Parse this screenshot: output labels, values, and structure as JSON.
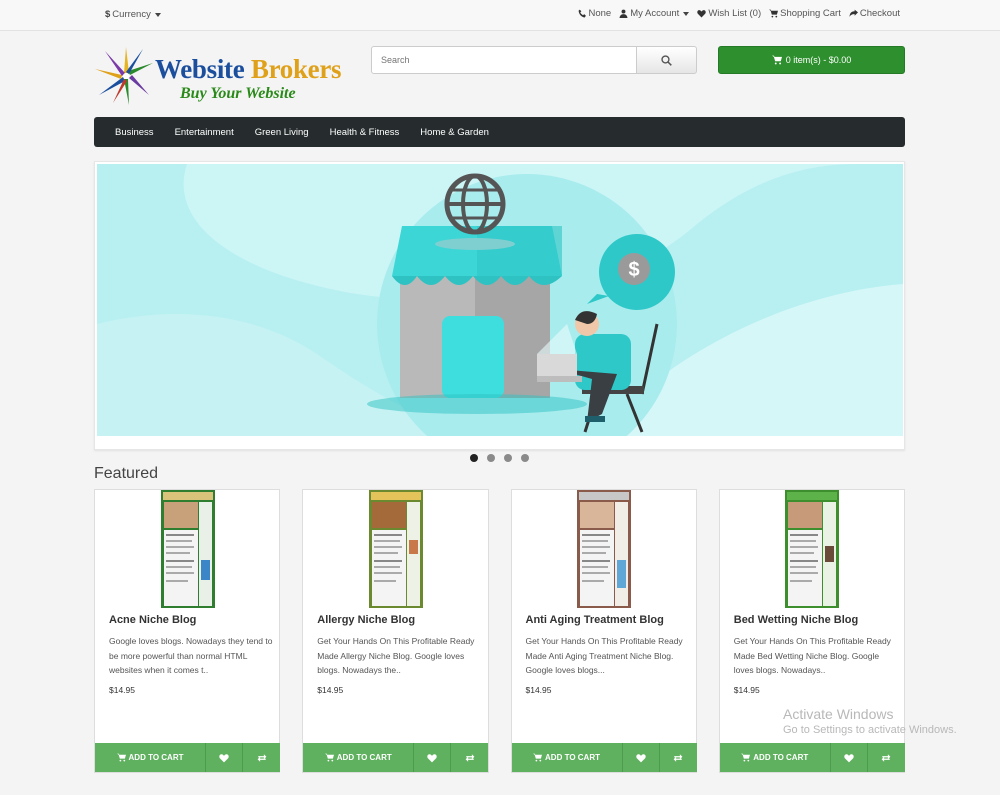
{
  "topbar": {
    "currency_symbol": "$",
    "currency_label": "Currency",
    "links": {
      "phone": "None",
      "account": "My Account",
      "wishlist": "Wish List (0)",
      "cart": "Shopping Cart",
      "checkout": "Checkout"
    }
  },
  "header": {
    "logo_word1": "Website",
    "logo_word2": "Brokers",
    "logo_tagline": "Buy Your Website",
    "search_placeholder": "Search",
    "cart_summary": "0 item(s) - $0.00"
  },
  "nav": {
    "items": [
      "Business",
      "Entertainment",
      "Green Living",
      "Health & Fitness",
      "Home & Garden"
    ]
  },
  "slider": {
    "dot_count": 4,
    "active_dot": 0
  },
  "featured": {
    "heading": "Featured",
    "add_to_cart_label": "ADD TO CART",
    "products": [
      {
        "name": "Acne Niche Blog",
        "description": "Google loves blogs. Nowadays they tend to be more powerful than normal HTML websites when it comes t..",
        "price": "$14.95"
      },
      {
        "name": "Allergy Niche Blog",
        "description": "Get Your Hands On This Profitable Ready Made Allergy Niche Blog. Google loves blogs. Nowadays the..",
        "price": "$14.95"
      },
      {
        "name": "Anti Aging Treatment Blog",
        "description": "Get Your Hands On This Profitable Ready Made Anti Aging Treatment Niche Blog. Google loves blogs...",
        "price": "$14.95"
      },
      {
        "name": "Bed Wetting Niche Blog",
        "description": "Get Your Hands On This Profitable Ready Made Bed Wetting Niche Blog. Google loves blogs. Nowadays..",
        "price": "$14.95"
      }
    ]
  },
  "watermark": {
    "line1": "Activate Windows",
    "line2": "Go to Settings to activate Windows."
  },
  "colors": {
    "nav_bg": "#262c2e",
    "cart_green": "#2d8f2d",
    "action_green": "#5fb05f",
    "slide_bg": "#b8f0f2"
  }
}
